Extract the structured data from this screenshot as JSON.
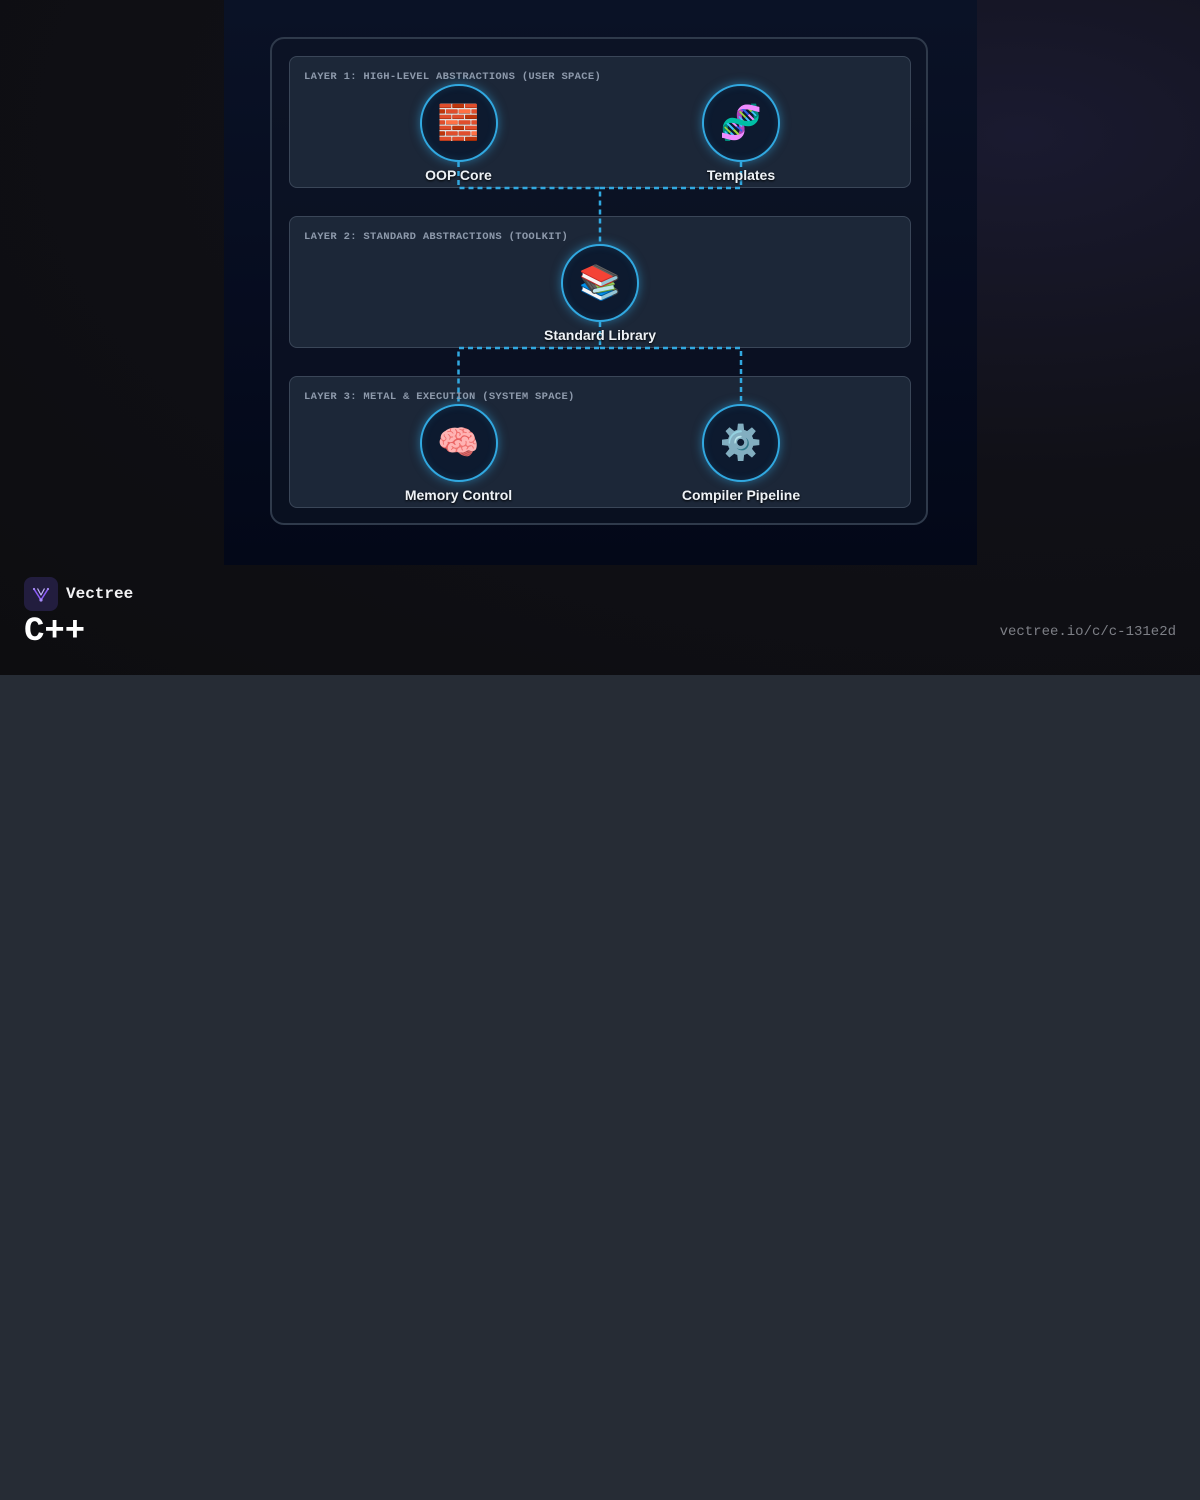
{
  "brand": {
    "name": "Vectree",
    "logo_icon": "vectree-logo-icon",
    "accent": "#8b5cf6"
  },
  "page": {
    "title": "C++",
    "url": "vectree.io/c/c-131e2d"
  },
  "diagram": {
    "accent": "#31a8e0",
    "layers": [
      {
        "title": "LAYER 1: HIGH-LEVEL ABSTRACTIONS (USER SPACE)",
        "nodes": [
          {
            "label": "OOP Core",
            "icon": "🧱",
            "icon_name": "brick-wall-icon"
          },
          {
            "label": "Templates",
            "icon": "🧬",
            "icon_name": "dna-icon"
          }
        ]
      },
      {
        "title": "LAYER 2: STANDARD ABSTRACTIONS (TOOLKIT)",
        "nodes": [
          {
            "label": "Standard Library",
            "icon": "📚",
            "icon_name": "books-icon"
          }
        ]
      },
      {
        "title": "LAYER 3: METAL & EXECUTION (SYSTEM SPACE)",
        "nodes": [
          {
            "label": "Memory Control",
            "icon": "🧠",
            "icon_name": "brain-icon"
          },
          {
            "label": "Compiler Pipeline",
            "icon": "⚙️",
            "icon_name": "gear-icon"
          }
        ]
      }
    ],
    "edges": [
      {
        "from": "OOP Core",
        "to": "Standard Library"
      },
      {
        "from": "Templates",
        "to": "Standard Library"
      },
      {
        "from": "Standard Library",
        "to": "Memory Control"
      },
      {
        "from": "Standard Library",
        "to": "Compiler Pipeline"
      }
    ]
  }
}
